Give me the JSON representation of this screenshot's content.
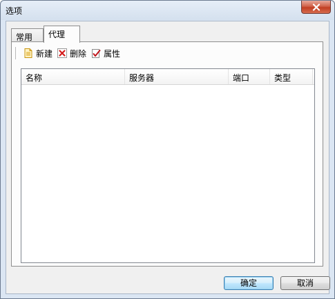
{
  "window": {
    "title": "选项",
    "close_icon": "close-icon"
  },
  "tabs": [
    {
      "label": "常用",
      "selected": false
    },
    {
      "label": "代理",
      "selected": true
    }
  ],
  "toolbar": {
    "new_label": "新建",
    "new_icon": "new-document-icon",
    "delete_label": "删除",
    "delete_icon": "delete-x-icon",
    "properties_label": "属性",
    "properties_icon": "properties-check-icon"
  },
  "proxy_list": {
    "columns": [
      "名称",
      "服务器",
      "端口",
      "类型"
    ],
    "rows": []
  },
  "buttons": {
    "ok_label": "确定",
    "cancel_label": "取消"
  },
  "colors": {
    "close_button": "#c23f22",
    "default_button_border": "#3c7fb1",
    "frame": "#dbe6f3"
  }
}
